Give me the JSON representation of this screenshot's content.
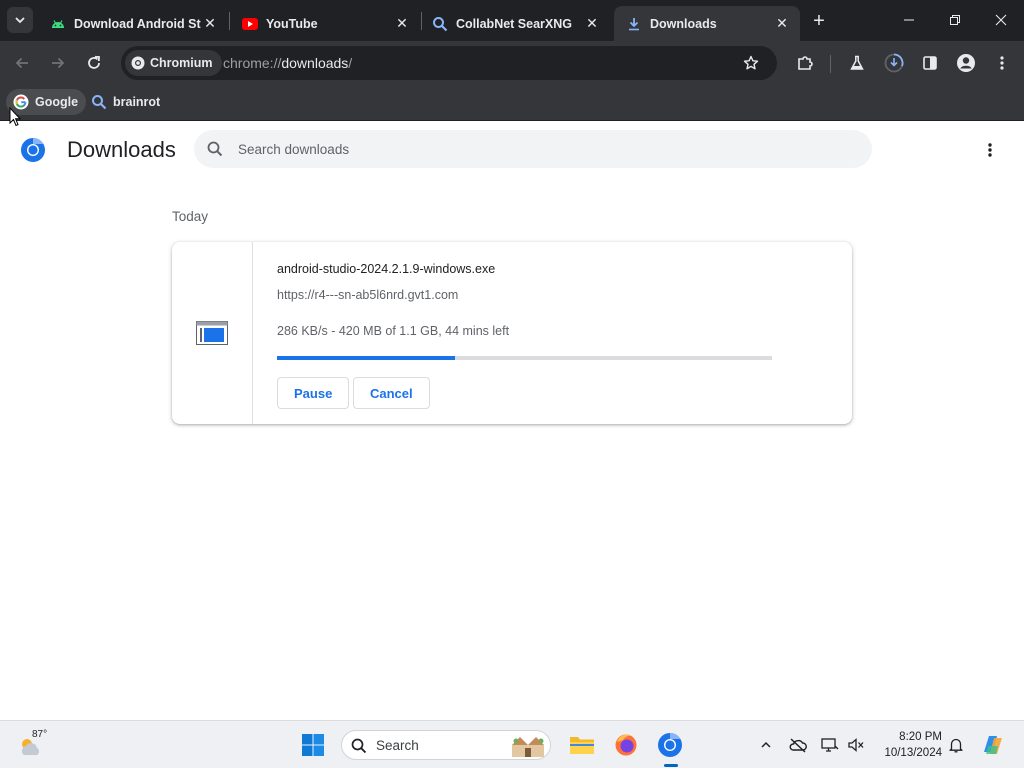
{
  "browser": {
    "tabs": [
      {
        "title": "Download Android St",
        "favicon": "android-icon",
        "active": false
      },
      {
        "title": "YouTube",
        "favicon": "youtube-icon",
        "active": false
      },
      {
        "title": "CollabNet SearXNG",
        "favicon": "search-icon",
        "active": false
      },
      {
        "title": "Downloads",
        "favicon": "download-icon",
        "active": true
      }
    ],
    "omnibox": {
      "chip_label": "Chromium",
      "url_scheme": "chrome://",
      "url_host": "downloads",
      "url_path": "/"
    },
    "bookmarks": [
      {
        "label": "Google",
        "icon": "google-icon"
      },
      {
        "label": "brainrot",
        "icon": "search-icon"
      }
    ]
  },
  "downloads_page": {
    "title": "Downloads",
    "search_placeholder": "Search downloads",
    "section_date": "Today",
    "items": [
      {
        "filename": "android-studio-2024.2.1.9-windows.exe",
        "url": "https://r4---sn-ab5l6nrd.gvt1.com",
        "status": "286 KB/s - 420 MB of 1.1 GB, 44 mins left",
        "progress": 0.36,
        "pause_label": "Pause",
        "cancel_label": "Cancel"
      }
    ]
  },
  "taskbar": {
    "weather_temp": "87°",
    "search_label": "Search",
    "time": "8:20 PM",
    "date": "10/13/2024"
  },
  "colors": {
    "accent": "#1a73e8",
    "tab_strip": "#202124",
    "toolbar": "#35363a"
  }
}
